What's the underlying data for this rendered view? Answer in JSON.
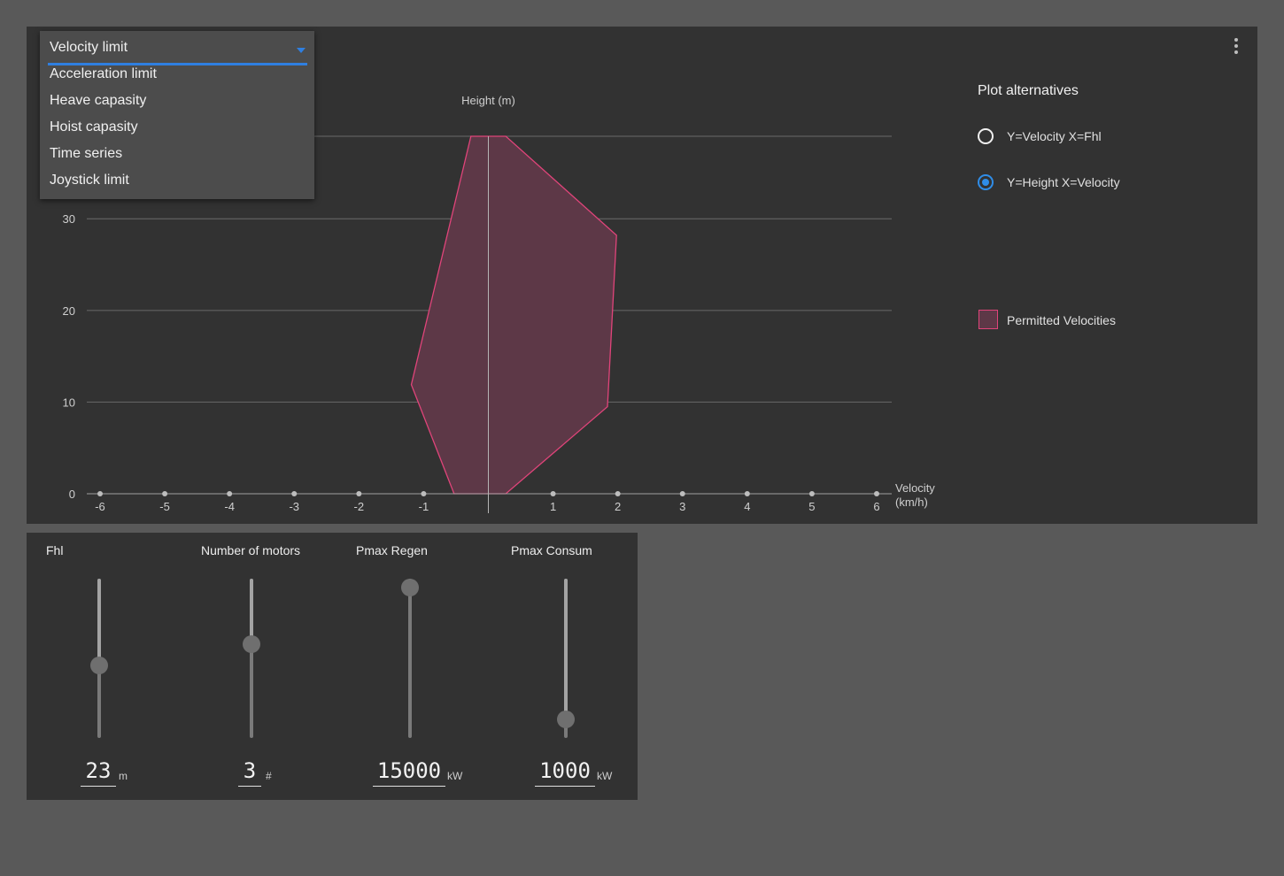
{
  "dropdown": {
    "selected": "Velocity limit",
    "options": [
      "Acceleration limit",
      "Heave capasity",
      "Hoist capasity",
      "Time series",
      "Joystick limit"
    ]
  },
  "side_panel": {
    "title": "Plot alternatives",
    "radios": [
      {
        "label": "Y=Velocity X=Fhl",
        "checked": false
      },
      {
        "label": "Y=Height X=Velocity",
        "checked": true
      }
    ],
    "legend_label": "Permitted Velocities"
  },
  "colors": {
    "polygon_fill": "#5d3847",
    "polygon_stroke": "#e0447a",
    "accent": "#2f8de8"
  },
  "icons": {
    "menu": "more-vert-icon",
    "dropdown": "arrow-drop-down-icon"
  },
  "chart_data": {
    "type": "area",
    "xlabel": "Velocity\n(km/h)",
    "ylabel": "Height (m)",
    "xlim": [
      -6,
      6
    ],
    "ylim": [
      0,
      39
    ],
    "x_ticks": [
      -6,
      -5,
      -4,
      -3,
      -2,
      -1,
      1,
      2,
      3,
      4,
      5,
      6
    ],
    "y_ticks": [
      0,
      10,
      20,
      30
    ],
    "grid": true,
    "series": [
      {
        "name": "Permitted Velocities",
        "polygon": [
          {
            "x": -0.27,
            "y": 39
          },
          {
            "x": 0.27,
            "y": 39
          },
          {
            "x": 1.98,
            "y": 28.2
          },
          {
            "x": 1.84,
            "y": 9.5
          },
          {
            "x": 0.27,
            "y": 0
          },
          {
            "x": -0.53,
            "y": 0
          },
          {
            "x": -1.19,
            "y": 11.9
          },
          {
            "x": -0.27,
            "y": 39
          }
        ]
      }
    ]
  },
  "params": [
    {
      "title": "Fhl",
      "value": "23",
      "unit": "m",
      "level": 0.45
    },
    {
      "title": "Number of motors",
      "value": "3",
      "unit": "#",
      "level": 0.6
    },
    {
      "title": "Pmax Regen",
      "value": "15000",
      "unit": "kW",
      "level": 1.0
    },
    {
      "title": "Pmax Consum",
      "value": "1000",
      "unit": "kW",
      "level": 0.07
    }
  ]
}
